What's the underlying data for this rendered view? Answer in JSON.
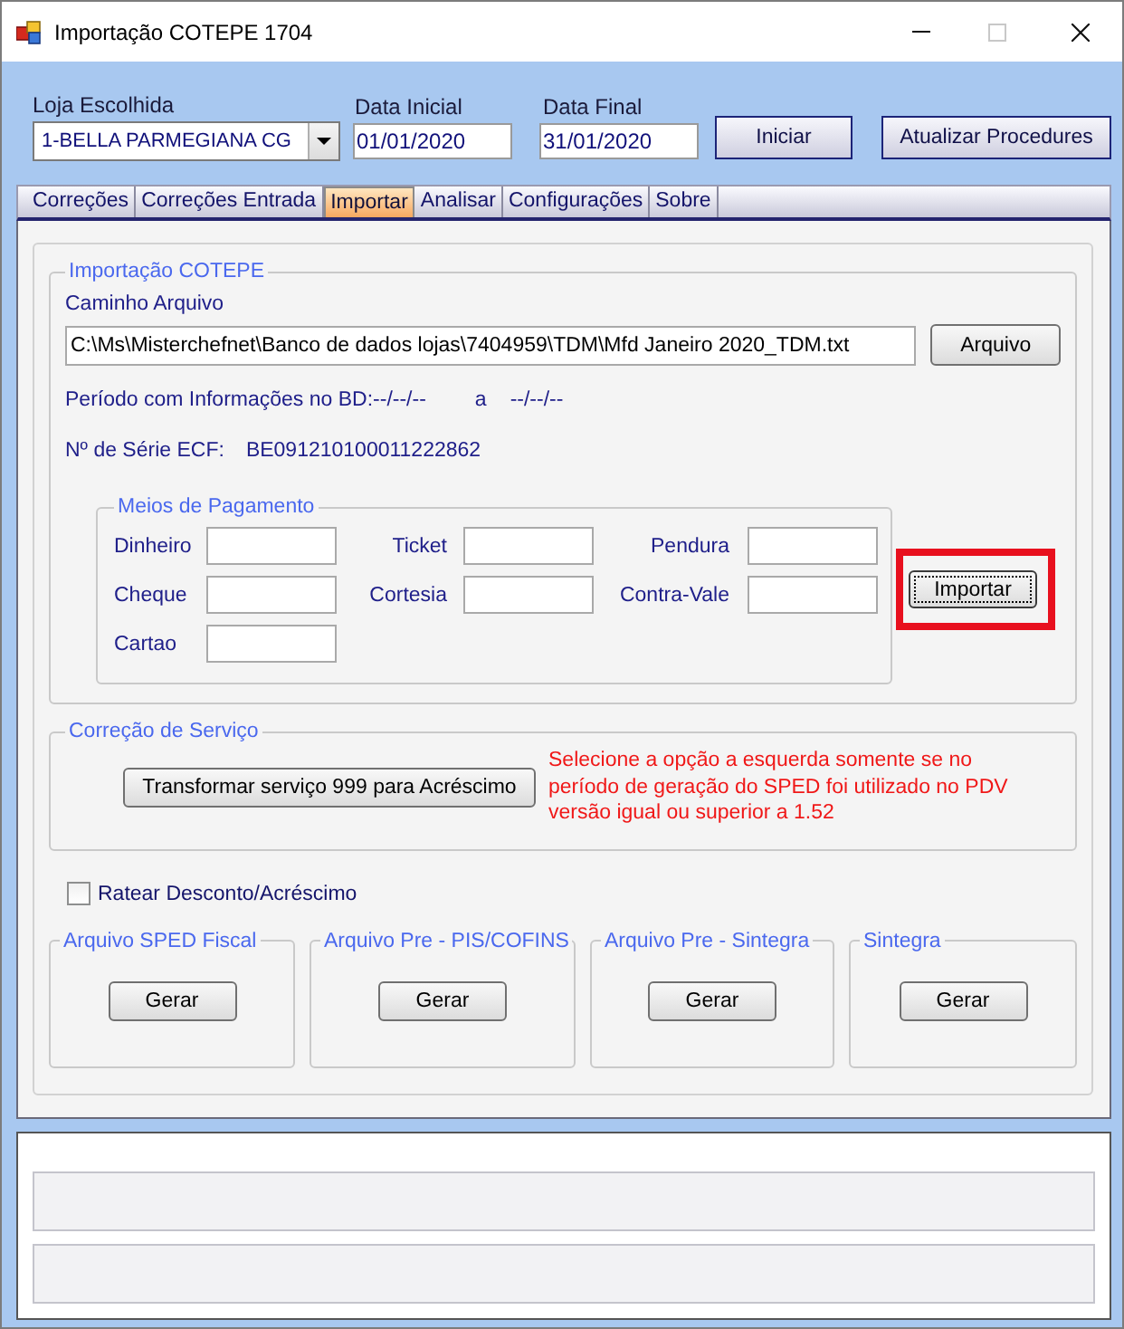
{
  "window": {
    "title": "Importação COTEPE 1704",
    "controls": [
      {
        "kind": "minimize",
        "disabled": false
      },
      {
        "kind": "maximize",
        "disabled": true
      },
      {
        "kind": "close",
        "disabled": false
      }
    ]
  },
  "header": {
    "store": {
      "label": "Loja Escolhida",
      "value": "1-BELLA PARMEGIANA CG"
    },
    "start_date": {
      "label": "Data Inicial",
      "value": "01/01/2020"
    },
    "end_date": {
      "label": "Data Final",
      "value": "31/01/2020"
    },
    "buttons": [
      "Iniciar",
      "Atualizar Procedures"
    ]
  },
  "tabs": [
    {
      "label": "Correções",
      "selected": false
    },
    {
      "label": "Correções Entrada",
      "selected": false
    },
    {
      "label": "Importar",
      "selected": true
    },
    {
      "label": "Analisar",
      "selected": false
    },
    {
      "label": "Configurações",
      "selected": false
    },
    {
      "label": "Sobre",
      "selected": false
    }
  ],
  "import_group": {
    "title": "Importação COTEPE",
    "path_label": "Caminho Arquivo",
    "path_value": "C:\\Ms\\Misterchefnet\\Banco de dados lojas\\7404959\\TDM\\Mfd Janeiro 2020_TDM.txt",
    "browse_button": "Arquivo",
    "period": {
      "label": "Período com Informações no BD:",
      "from": "--/--/--",
      "separator": "a",
      "to": "--/--/--"
    },
    "serial": {
      "label": "Nº de Série ECF:",
      "value": "BE091210100011222862"
    },
    "payments": {
      "title": "Meios de Pagamento",
      "fields": [
        {
          "label": "Dinheiro"
        },
        {
          "label": "Ticket"
        },
        {
          "label": "Pendura"
        },
        {
          "label": "Cheque"
        },
        {
          "label": "Cortesia"
        },
        {
          "label": "Contra-Vale"
        },
        {
          "label": "Cartao"
        }
      ]
    },
    "import_button": {
      "label": "Importar",
      "focused": true,
      "highlighted": true
    }
  },
  "service_group": {
    "title": "Correção de Serviço",
    "button": "Transformar serviço 999 para Acréscimo",
    "note": "Selecione a opção a esquerda somente se no\nperíodo de geração do SPED foi utilizado no PDV\nversão igual ou superior a 1.52"
  },
  "checkbox": {
    "label": "Ratear Desconto/Acréscimo",
    "checked": false
  },
  "exports": [
    {
      "title": "Arquivo SPED Fiscal",
      "button": "Gerar"
    },
    {
      "title": "Arquivo Pre - PIS/COFINS",
      "button": "Gerar"
    },
    {
      "title": "Arquivo Pre - Sintegra",
      "button": "Gerar"
    },
    {
      "title": "Sintegra",
      "button": "Gerar"
    }
  ]
}
